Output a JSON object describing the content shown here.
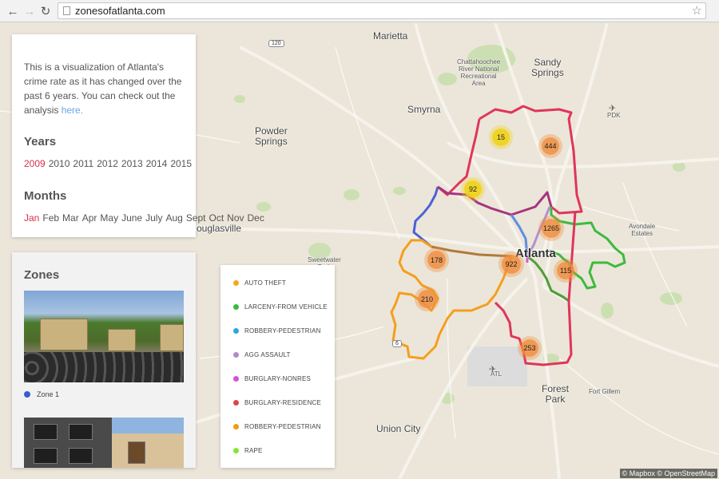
{
  "browser": {
    "url": "zonesofatlanta.com",
    "back_icon": "arrow-left-icon",
    "forward_icon": "arrow-right-icon",
    "reload_icon": "reload-icon",
    "bookmark_icon": "star-icon"
  },
  "sidebar": {
    "intro_text": "This is a visualization of Atlanta's crime rate as it has changed over the past 6 years. You can check out the analysis",
    "intro_link": "here.",
    "years_title": "Years",
    "years": [
      "2009",
      "2010",
      "2011",
      "2012",
      "2013",
      "2014",
      "2015"
    ],
    "selected_year": "2009",
    "months_title": "Months",
    "months": [
      "Jan",
      "Feb",
      "Mar",
      "Apr",
      "May",
      "June",
      "July",
      "Aug",
      "Sept",
      "Oct",
      "Nov",
      "Dec"
    ],
    "selected_month": "Jan",
    "zones_title": "Zones",
    "zones": [
      {
        "label": "Zone 1",
        "color": "#3b5bd6"
      }
    ]
  },
  "legend": {
    "items": [
      {
        "label": "AUTO THEFT",
        "color": "#f5a81d"
      },
      {
        "label": "LARCENY-FROM VEHICLE",
        "color": "#3db83d"
      },
      {
        "label": "ROBBERY-PEDESTRIAN",
        "color": "#2aa7e0"
      },
      {
        "label": "AGG ASSAULT",
        "color": "#b38ac7"
      },
      {
        "label": "BURGLARY-NONRES",
        "color": "#d94fd9"
      },
      {
        "label": "BURGLARY-RESIDENCE",
        "color": "#e0454a"
      },
      {
        "label": "ROBBERY-PEDESTRIAN",
        "color": "#f59a0e"
      },
      {
        "label": "RAPE",
        "color": "#86e62e"
      }
    ]
  },
  "map": {
    "places": {
      "marietta": "Marietta",
      "sandy_springs": "Sandy\nSprings",
      "chattahoochee": "Chattahoochee\nRiver National\nRecreational\nArea",
      "smyrna": "Smyrna",
      "powder_springs": "Powder\nSprings",
      "pdk": "PDK",
      "avondale": "Avondale\nEstates",
      "douglasville": "ouglasville",
      "sweetwater": "Sweetwater\nPark",
      "atlanta": "Atlanta",
      "atl": "ATL",
      "forest_park": "Forest\nPark",
      "fort_gillem": "Fort Gillem",
      "union_city": "Union City"
    },
    "shields": {
      "r120": "120",
      "r6": "6"
    },
    "clusters": [
      {
        "value": "15",
        "color": "yellow"
      },
      {
        "value": "444",
        "color": "orange"
      },
      {
        "value": "92",
        "color": "yellow"
      },
      {
        "value": "1265",
        "color": "orange"
      },
      {
        "value": "178",
        "color": "orange"
      },
      {
        "value": "922",
        "color": "orange"
      },
      {
        "value": "115",
        "color": "orange"
      },
      {
        "value": "210",
        "color": "orange"
      },
      {
        "value": "253",
        "color": "orange"
      }
    ],
    "attribution": "© Mapbox © OpenStreetMap"
  }
}
